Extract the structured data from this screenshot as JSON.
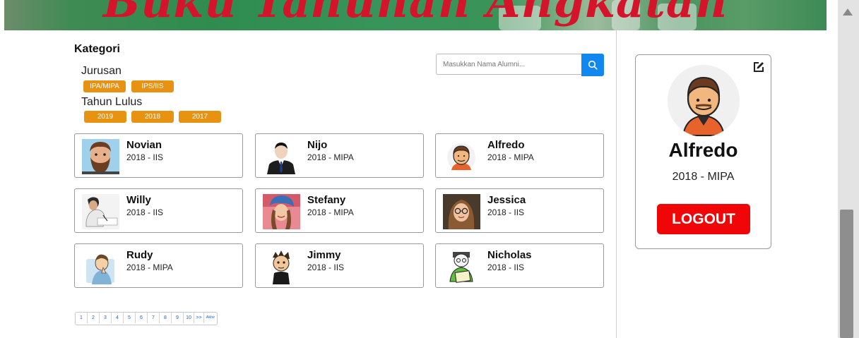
{
  "header": {
    "banner_text": "Buku Tahunan Angkatan"
  },
  "kategori": {
    "title": "Kategori",
    "jurusan": {
      "label": "Jurusan",
      "options": [
        "IPA/MIPA",
        "IPS/IIS"
      ]
    },
    "tahun_lulus": {
      "label": "Tahun Lulus",
      "options": [
        "2019",
        "2018",
        "2017"
      ]
    }
  },
  "search": {
    "placeholder": "Masukkan Nama Alumni...",
    "value": "",
    "icon": "search-icon"
  },
  "alumni": [
    {
      "name": "Novian",
      "meta": "2018 - IIS",
      "avatar": "bearded-man-avatar"
    },
    {
      "name": "Nijo",
      "meta": "2018 - MIPA",
      "avatar": "businessman-avatar"
    },
    {
      "name": "Alfredo",
      "meta": "2018 - MIPA",
      "avatar": "cartoon-man-avatar"
    },
    {
      "name": "Willy",
      "meta": "2018 - IIS",
      "avatar": "student-writing-photo"
    },
    {
      "name": "Stefany",
      "meta": "2018 - MIPA",
      "avatar": "woman-beanie-photo"
    },
    {
      "name": "Jessica",
      "meta": "2018 - IIS",
      "avatar": "woman-glasses-photo"
    },
    {
      "name": "Rudy",
      "meta": "2018 - MIPA",
      "avatar": "cartoon-thinker-avatar"
    },
    {
      "name": "Jimmy",
      "meta": "2018 - IIS",
      "avatar": "cartoon-boy-avatar"
    },
    {
      "name": "Nicholas",
      "meta": "2018 - IIS",
      "avatar": "cartoon-reader-avatar"
    }
  ],
  "pagination": {
    "pages": [
      "1",
      "2",
      "3",
      "4",
      "5",
      "6",
      "7",
      "8",
      "9",
      "10",
      ">>",
      "Akhir"
    ]
  },
  "profile": {
    "name": "Alfredo",
    "meta": "2018 - MIPA",
    "logout_label": "LOGOUT",
    "edit_icon": "edit-icon"
  },
  "colors": {
    "chip": "#e89212",
    "search_button": "#1188f0",
    "logout": "#f00606",
    "link": "#1a66c9"
  }
}
